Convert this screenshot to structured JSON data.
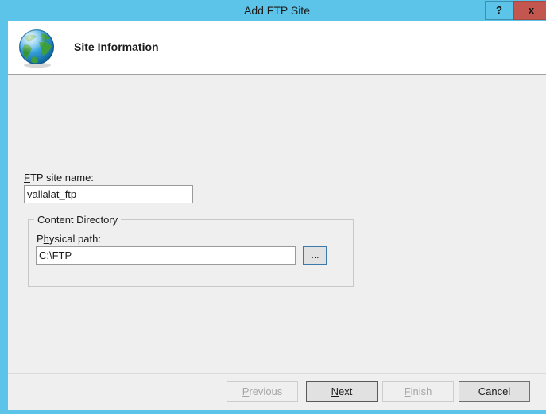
{
  "window": {
    "title": "Add FTP Site",
    "help_button": "?",
    "close_button": "x",
    "titlebar_color": "#5bc4e8",
    "close_button_color": "#c3564f",
    "body_color": "#efefef"
  },
  "header": {
    "title": "Site Information",
    "icon": "globe-icon"
  },
  "form": {
    "site_name": {
      "label_accel": "F",
      "label_rest": "TP site name:",
      "value": "vallalat_ftp",
      "placeholder": ""
    },
    "content_directory": {
      "group_title": "Content Directory",
      "physical_path": {
        "label_accel_prefix": "P",
        "label_accel": "h",
        "label_rest": "ysical path:",
        "value": "C:\\FTP",
        "placeholder": ""
      },
      "browse_button": "..."
    }
  },
  "footer": {
    "previous": {
      "accel": "P",
      "rest": "revious",
      "enabled": false
    },
    "next": {
      "accel": "N",
      "rest": "ext",
      "enabled": true,
      "is_default": true
    },
    "finish": {
      "accel": "F",
      "rest": "inish",
      "enabled": false
    },
    "cancel": {
      "label": "Cancel",
      "enabled": true
    }
  }
}
